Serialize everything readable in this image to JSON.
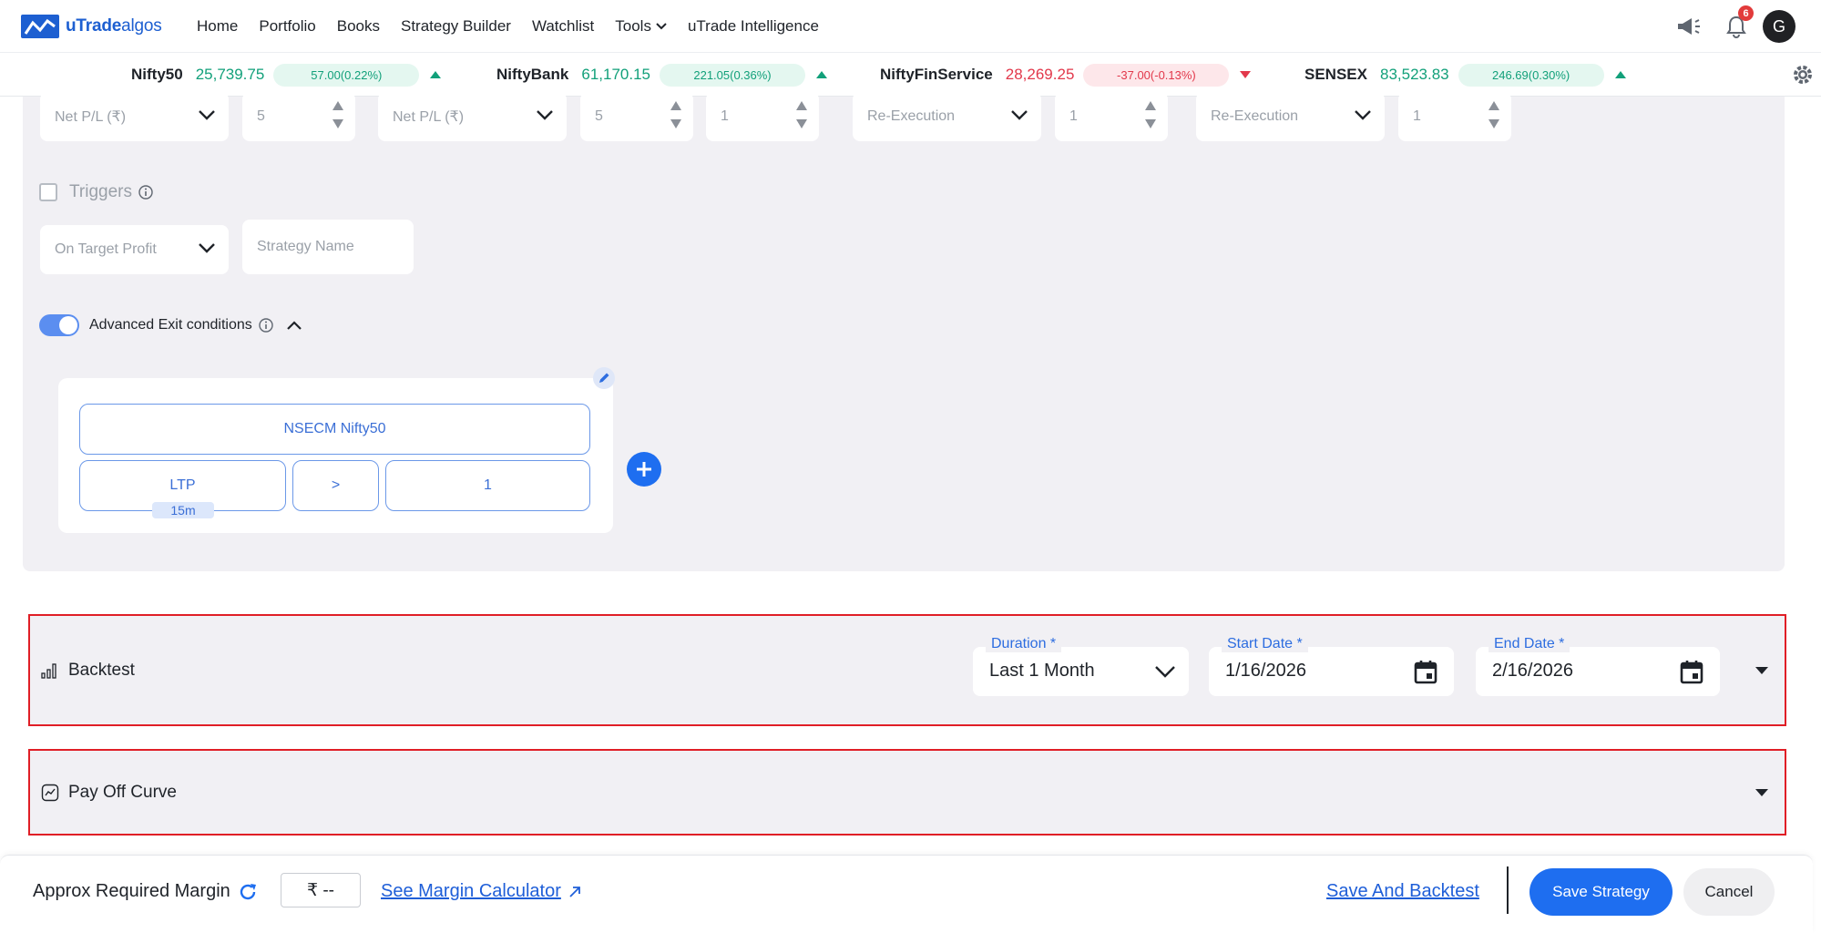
{
  "brand": {
    "name_bold": "uTrade",
    "name_light": "algos"
  },
  "nav": {
    "items": [
      {
        "label": "Home"
      },
      {
        "label": "Portfolio"
      },
      {
        "label": "Books"
      },
      {
        "label": "Strategy Builder"
      },
      {
        "label": "Watchlist"
      },
      {
        "label": "Tools"
      },
      {
        "label": "uTrade Intelligence"
      }
    ],
    "notification_count": "6",
    "avatar_initial": "G"
  },
  "ticker": [
    {
      "name": "Nifty50",
      "value": "25,739.75",
      "change": "57.00(0.22%)",
      "direction": "up"
    },
    {
      "name": "NiftyBank",
      "value": "61,170.15",
      "change": "221.05(0.36%)",
      "direction": "up"
    },
    {
      "name": "NiftyFinService",
      "value": "28,269.25",
      "change": "-37.00(-0.13%)",
      "direction": "down"
    },
    {
      "name": "SENSEX",
      "value": "83,523.83",
      "change": "246.69(0.30%)",
      "direction": "up"
    }
  ],
  "exit_rules": {
    "row1": [
      {
        "kind": "select",
        "value": "Net P/L (₹)"
      },
      {
        "kind": "number",
        "value": "5"
      },
      {
        "kind": "select",
        "value": "Net P/L (₹)"
      },
      {
        "kind": "number",
        "value": "5"
      },
      {
        "kind": "number",
        "value": "1"
      },
      {
        "kind": "select",
        "value": "Re-Execution"
      },
      {
        "kind": "number",
        "value": "1"
      },
      {
        "kind": "select",
        "value": "Re-Execution"
      },
      {
        "kind": "number",
        "value": "1"
      }
    ],
    "triggers_label": "Triggers",
    "trigger_select": "On Target Profit",
    "strategy_name_placeholder": "Strategy Name",
    "advanced_exit_label": "Advanced Exit conditions"
  },
  "condition": {
    "instrument": "NSECM Nifty50",
    "field": "LTP",
    "timeframe": "15m",
    "operator": ">",
    "value": "1"
  },
  "backtest": {
    "title": "Backtest",
    "duration_label": "Duration *",
    "duration_value": "Last 1 Month",
    "start_label": "Start Date *",
    "start_value": "1/16/2026",
    "end_label": "End Date *",
    "end_value": "2/16/2026"
  },
  "payoff": {
    "title": "Pay Off Curve"
  },
  "footer": {
    "margin_label": "Approx Required Margin",
    "margin_value": "₹ --",
    "margin_calc_link": "See Margin Calculator",
    "save_backtest": "Save And Backtest",
    "save_strategy": "Save Strategy",
    "cancel": "Cancel"
  },
  "colors": {
    "accent": "#1e6ef0",
    "up": "#12a07a",
    "down": "#e2384b",
    "panel_bg": "#f1f0f4",
    "highlight_border": "#e01e26"
  }
}
